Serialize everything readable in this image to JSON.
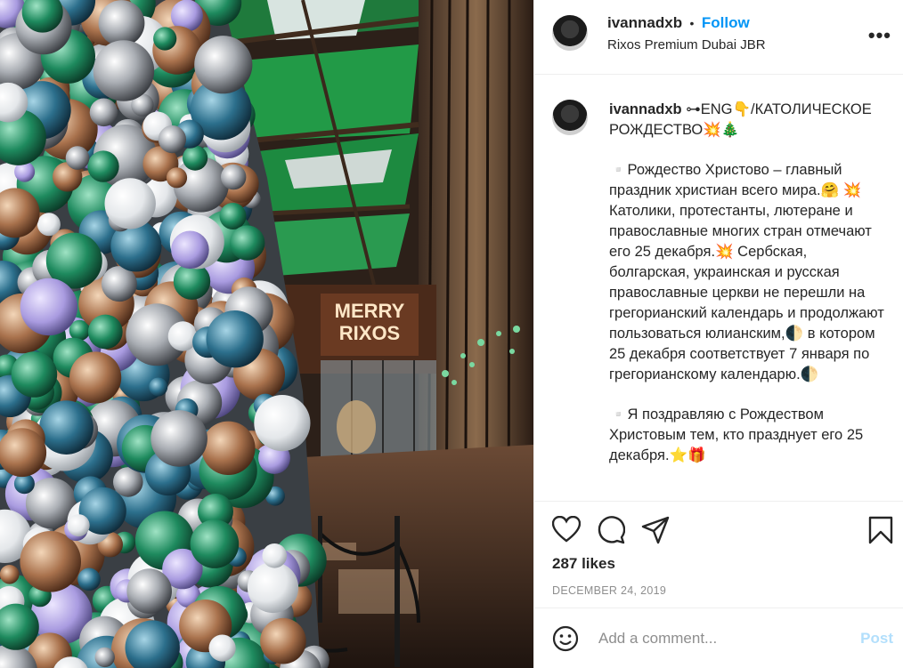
{
  "header": {
    "username": "ivannadxb",
    "separator": "•",
    "follow_label": "Follow",
    "location": "Rixos Premium Dubai JBR",
    "more_icon": "more-horizontal-icon"
  },
  "photo": {
    "sign_line1": "MERRY",
    "sign_line2": "RIXOS"
  },
  "caption": {
    "username": "ivannadxb",
    "intro": "⊶ENG👇/КАТОЛИЧЕСКОЕ РОЖДЕСТВО💥🎄",
    "para1": "▫️Рождество Христово – главный праздник христиан всего мира.🤗 💥 Католики, протестанты, лютеране и православные многих стран отмечают его 25 декабря.💥 Сербская, болгарская, украинская и русская православные церкви не перешли на грегорианский календарь и продолжают пользоваться юлианским,🌓 в котором 25 декабря соответствует 7 января по грегорианскому календарю.🌓",
    "para2": "▫️Я поздравляю с Рождеством Христовым тем, кто празднует его 25 декабря.⭐🎁"
  },
  "actions": {
    "like_icon": "heart-icon",
    "comment_icon": "comment-icon",
    "share_icon": "paper-plane-icon",
    "save_icon": "bookmark-icon",
    "likes": "287 likes",
    "date": "DECEMBER 24, 2019"
  },
  "comment_box": {
    "emoji_icon": "smiley-icon",
    "placeholder": "Add a comment...",
    "post_label": "Post"
  },
  "colors": {
    "accent": "#0095f6",
    "post_disabled": "#b2dffc",
    "muted": "#8e8e8e"
  }
}
